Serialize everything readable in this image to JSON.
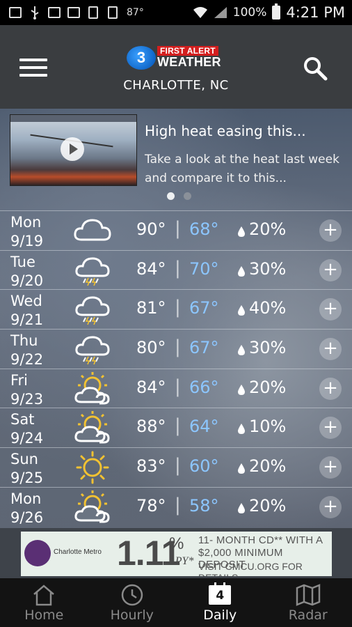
{
  "status_bar": {
    "temperature": "87°",
    "battery": "100%",
    "time": "4:21 PM"
  },
  "header": {
    "logo_number": "3",
    "logo_top": "FIRST ALERT",
    "logo_bottom": "WEATHER",
    "city": "CHARLOTTE, NC"
  },
  "news": {
    "headline": "High heat easing this...",
    "description": "Take a look at the heat last week and compare it to this..."
  },
  "forecast": [
    {
      "day": "Mon",
      "date": "9/19",
      "icon": "cloudy-icon",
      "high": "90°",
      "low": "68°",
      "precip": "20%"
    },
    {
      "day": "Tue",
      "date": "9/20",
      "icon": "thunderstorm-icon",
      "high": "84°",
      "low": "70°",
      "precip": "30%"
    },
    {
      "day": "Wed",
      "date": "9/21",
      "icon": "thunderstorm-icon",
      "high": "81°",
      "low": "67°",
      "precip": "40%"
    },
    {
      "day": "Thu",
      "date": "9/22",
      "icon": "thunderstorm-icon",
      "high": "80°",
      "low": "67°",
      "precip": "30%"
    },
    {
      "day": "Fri",
      "date": "9/23",
      "icon": "partly-cloudy-icon",
      "high": "84°",
      "low": "66°",
      "precip": "20%"
    },
    {
      "day": "Sat",
      "date": "9/24",
      "icon": "partly-cloudy-icon",
      "high": "88°",
      "low": "64°",
      "precip": "10%"
    },
    {
      "day": "Sun",
      "date": "9/25",
      "icon": "sunny-icon",
      "high": "83°",
      "low": "60°",
      "precip": "20%"
    },
    {
      "day": "Mon",
      "date": "9/26",
      "icon": "partly-cloudy-icon",
      "high": "78°",
      "low": "58°",
      "precip": "20%"
    }
  ],
  "ad": {
    "brand": "Charlotte Metro",
    "rate": "1.11",
    "rate_suffix": "%",
    "apy": "APY*",
    "line1": "11- MONTH CD** WITH A",
    "line2": "$2,000 MINIMUM DEPOSIT",
    "line3": "VISIT CMCU.ORG FOR DETAILS"
  },
  "nav": {
    "home": "Home",
    "hourly": "Hourly",
    "daily": "Daily",
    "daily_badge": "4",
    "radar": "Radar"
  },
  "colors": {
    "low_temp": "#8cc6ff",
    "header_bg": "#3a3d40",
    "logo_red": "#d41e1e",
    "logo_blue": "#0050b3"
  }
}
